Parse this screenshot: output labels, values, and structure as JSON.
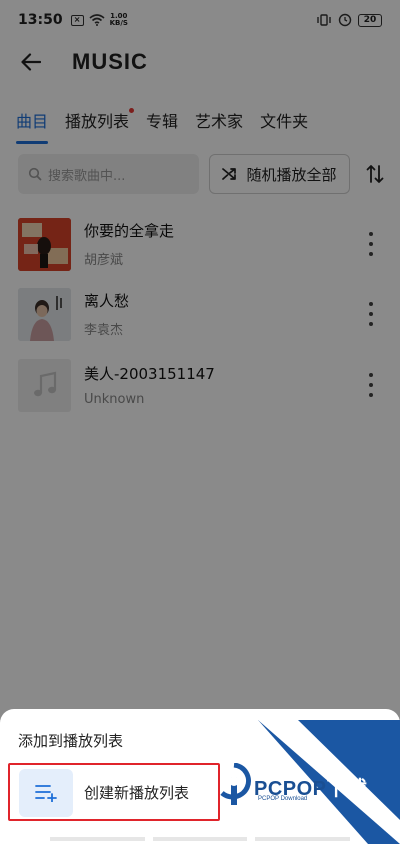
{
  "status_bar": {
    "time": "13:50",
    "speed_value": "1.00",
    "speed_unit": "KB/S",
    "battery": "20"
  },
  "header": {
    "title": "MUSIC"
  },
  "tabs": [
    {
      "label": "曲目",
      "active": true
    },
    {
      "label": "播放列表",
      "badge_dot": true
    },
    {
      "label": "专辑"
    },
    {
      "label": "艺术家"
    },
    {
      "label": "文件夹"
    }
  ],
  "search": {
    "placeholder": "搜索歌曲中..."
  },
  "shuffle_button": {
    "label": "随机播放全部"
  },
  "songs": [
    {
      "title": "你要的全拿走",
      "artist": "胡彦斌"
    },
    {
      "title": "离人愁",
      "artist": "李袁杰"
    },
    {
      "title": "美人-2003151147",
      "artist": "Unknown"
    }
  ],
  "sheet": {
    "title": "添加到播放列表",
    "create_label": "创建新播放列表"
  },
  "watermark": {
    "brand": "PCPOP",
    "brand_suffix": "下载",
    "sub": "PCPOP Download"
  },
  "colors": {
    "accent": "#1e6fd8",
    "highlight_border": "#e0242b",
    "watermark": "#1a4f93"
  }
}
